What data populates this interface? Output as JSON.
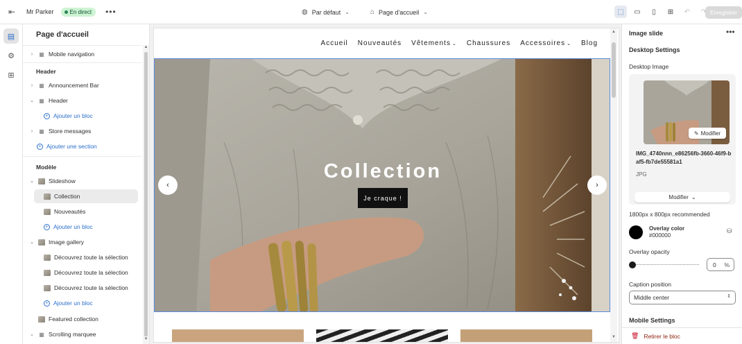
{
  "topbar": {
    "store_name": "Mr Parker",
    "status_badge": "En direct",
    "theme_selector": "Par défaut",
    "page_selector": "Page d'accueil",
    "save_label": "Enregistrer"
  },
  "sidebar": {
    "title": "Page d'accueil",
    "rows": {
      "mobile_navigation": "Mobile navigation",
      "header_group": "Header",
      "announcement_bar": "Announcement Bar",
      "header": "Header",
      "header_add_block": "Ajouter un bloc",
      "store_messages": "Store messages",
      "add_section": "Ajouter une section",
      "template_group": "Modèle",
      "slideshow": "Slideshow",
      "collection": "Collection",
      "nouveautes": "Nouveautés",
      "slideshow_add_block": "Ajouter un bloc",
      "image_gallery": "Image gallery",
      "gallery_item_1": "Découvrez toute la sélection",
      "gallery_item_2": "Découvrez toute la sélection",
      "gallery_item_3": "Découvrez toute la sélection",
      "gallery_add_block": "Ajouter un bloc",
      "featured_collection": "Featured collection",
      "scrolling_marquee": "Scrolling marquee"
    }
  },
  "preview": {
    "nav": [
      "Accueil",
      "Nouveautés",
      "Vêtements",
      "Chaussures",
      "Accessoires",
      "Blog"
    ],
    "hero_title": "Collection",
    "hero_button": "Je craque !"
  },
  "settings": {
    "title": "Image slide",
    "desktop_settings": "Desktop Settings",
    "desktop_image_label": "Desktop Image",
    "image_modify_overlay": "Modifier",
    "image_name": "IMG_4740nnn_e86256fb-3660-46f9-baf5-fb7de55581a1",
    "image_type": "JPG",
    "image_modify_button": "Modifier",
    "size_hint": "1800px x 800px recommended",
    "overlay_color_label": "Overlay color",
    "overlay_color_value": "#000000",
    "overlay_opacity_label": "Overlay opacity",
    "overlay_opacity_value": "0",
    "percent": "%",
    "caption_position_label": "Caption position",
    "caption_position_value": "Middle center",
    "mobile_settings": "Mobile Settings",
    "remove_block": "Retirer le bloc"
  },
  "colors": {
    "accent": "#2c6ecb",
    "live_badge_bg": "#cdf3d3",
    "danger": "#8e1f0b"
  }
}
